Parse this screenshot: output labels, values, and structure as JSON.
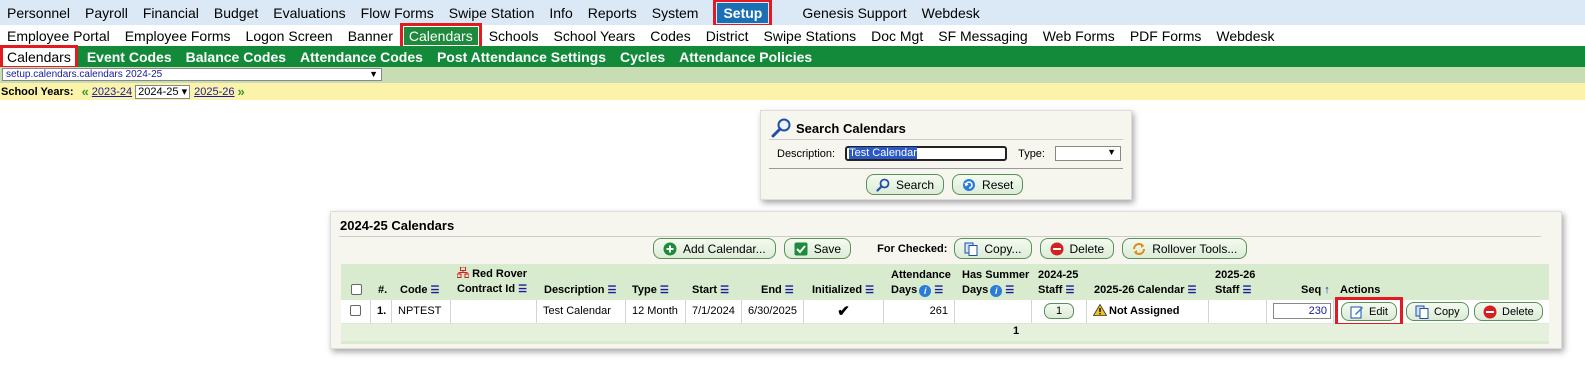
{
  "top_menu": [
    "Personnel",
    "Payroll",
    "Financial",
    "Budget",
    "Evaluations",
    "Flow Forms",
    "Swipe Station",
    "Info",
    "Reports",
    "System",
    "Setup",
    "Genesis Support",
    "Webdesk"
  ],
  "second_menu": [
    "Employee Portal",
    "Employee Forms",
    "Logon Screen",
    "Banner",
    "Calendars",
    "Schools",
    "School Years",
    "Codes",
    "District",
    "Swipe Stations",
    "Doc Mgt",
    "SF Messaging",
    "Web Forms",
    "PDF Forms",
    "Webdesk"
  ],
  "tabs": [
    "Calendars",
    "Event Codes",
    "Balance Codes",
    "Attendance Codes",
    "Post Attendance Settings",
    "Cycles",
    "Attendance Policies"
  ],
  "path_select": "setup.calendars.calendars 2024-25",
  "school_years": {
    "label": "School Years:",
    "prev": "2023-24",
    "current": "2024-25",
    "next": "2025-26"
  },
  "search": {
    "title": "Search Calendars",
    "description_label": "Description:",
    "description_value": "Test Calendar",
    "type_label": "Type:",
    "type_value": "",
    "search_button": "Search",
    "reset_button": "Reset"
  },
  "panel": {
    "title": "2024-25 Calendars",
    "add_button": "Add Calendar...",
    "save_button": "Save",
    "for_checked": "For Checked:",
    "copy_button": "Copy...",
    "delete_button": "Delete",
    "rollover_button": "Rollover Tools..."
  },
  "columns": {
    "num": "#.",
    "code": "Code",
    "red_rover_1": "Red Rover",
    "red_rover_2": "Contract Id",
    "description": "Description",
    "type": "Type",
    "start": "Start",
    "end": "End",
    "initialized": "Initialized",
    "att_days_1": "Attendance",
    "att_days_2": "Days",
    "summer_1": "Has Summer",
    "summer_2": "Days",
    "staff_2425_1": "2024-25",
    "staff_2425_2": "Staff",
    "cal_2526": "2025-26 Calendar",
    "staff_2526_1": "2025-26",
    "staff_2526_2": "Staff",
    "seq": "Seq",
    "actions": "Actions"
  },
  "row": {
    "num": "1.",
    "code": "NPTEST",
    "red_rover": "",
    "description": "Test Calendar",
    "type": "12 Month",
    "start": "7/1/2024",
    "end": "6/30/2025",
    "initialized": "✔",
    "attendance_days": "261",
    "summer_days": "",
    "staff_2425": "1",
    "cal_2526": "Not Assigned",
    "staff_2526": "",
    "seq": "230",
    "edit": "Edit",
    "copy": "Copy",
    "delete": "Delete"
  },
  "total": "1",
  "colors": {
    "menu_bg": "#dbe9f6",
    "tab_bar": "#138a3a",
    "year_bar": "#fbf3a9",
    "highlight": "#e21b23",
    "grid_bg": "#d9ebcf"
  }
}
